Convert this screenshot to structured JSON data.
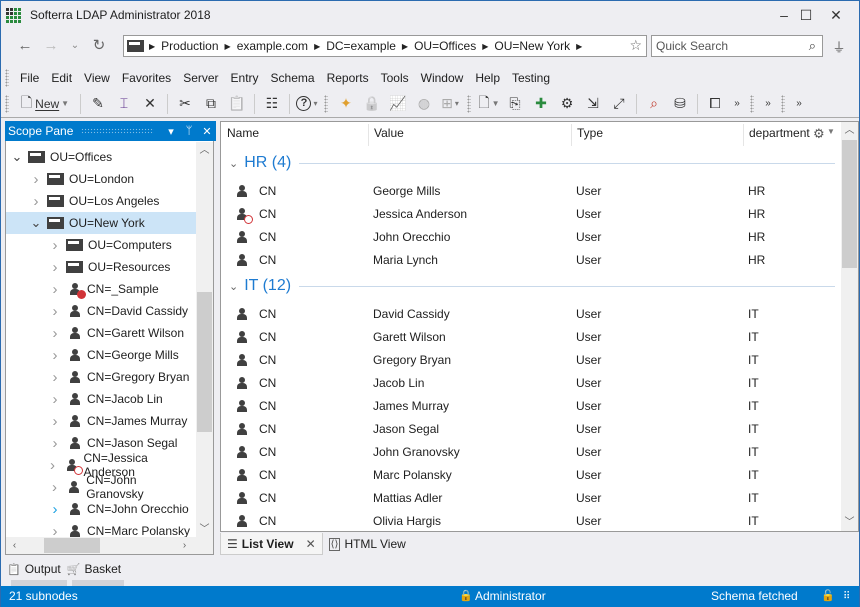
{
  "window": {
    "title": "Softerra LDAP Administrator 2018",
    "controls": {
      "minimize": "–",
      "maximize": "☐",
      "close": "✕"
    }
  },
  "nav": {
    "back_icon": "←",
    "forward_icon": "→",
    "history_icon": "⌄",
    "refresh_icon": "↻",
    "breadcrumbs": [
      "Production",
      "example.com",
      "DC=example",
      "OU=Offices",
      "OU=New York"
    ],
    "favorite_icon": "☆",
    "search_placeholder": "Quick Search",
    "search_value": "",
    "search_icon": "⌕",
    "connect_icon": "⏚"
  },
  "menu": [
    "File",
    "Edit",
    "View",
    "Favorites",
    "Server",
    "Entry",
    "Schema",
    "Reports",
    "Tools",
    "Window",
    "Help",
    "Testing"
  ],
  "toolbar": {
    "new_label": "New",
    "icons": {
      "new": "🗋",
      "edit": "✎",
      "rename": "⌶",
      "delete": "✕",
      "cut": "✂",
      "copy": "⧉",
      "paste": "📋",
      "properties": "☷",
      "help": "?",
      "new_entry": "✦",
      "lock": "🔒",
      "monitor": "📈",
      "web": "◍",
      "tree": "⊞",
      "new2": "🗋",
      "export": "⎘",
      "add_edit": "✚",
      "settings": "⚙",
      "import": "⇲",
      "expand": "⤢",
      "find": "⌕",
      "db": "⛁",
      "windows": "⧠",
      "more": "»"
    }
  },
  "scope_pane": {
    "title": "Scope Pane",
    "dropdown_icon": "▾",
    "pin_icon": "📌",
    "close_icon": "✕",
    "nodes": [
      {
        "label": "OU=Offices",
        "level": 0,
        "type": "folder",
        "expanded": true
      },
      {
        "label": "OU=London",
        "level": 1,
        "type": "folder",
        "expanded": false
      },
      {
        "label": "OU=Los Angeles",
        "level": 1,
        "type": "folder",
        "expanded": false
      },
      {
        "label": "OU=New York",
        "level": 1,
        "type": "folder",
        "expanded": true,
        "selected": true
      },
      {
        "label": "OU=Computers",
        "level": 2,
        "type": "folder",
        "expanded": false
      },
      {
        "label": "OU=Resources",
        "level": 2,
        "type": "folder",
        "expanded": false
      },
      {
        "label": "CN=_Sample",
        "level": 2,
        "type": "user-disabled",
        "expanded": false
      },
      {
        "label": "CN=David Cassidy",
        "level": 2,
        "type": "user",
        "expanded": false
      },
      {
        "label": "CN=Garett Wilson",
        "level": 2,
        "type": "user",
        "expanded": false
      },
      {
        "label": "CN=George Mills",
        "level": 2,
        "type": "user",
        "expanded": false
      },
      {
        "label": "CN=Gregory Bryan",
        "level": 2,
        "type": "user",
        "expanded": false
      },
      {
        "label": "CN=Jacob Lin",
        "level": 2,
        "type": "user",
        "expanded": false
      },
      {
        "label": "CN=James Murray",
        "level": 2,
        "type": "user",
        "expanded": false
      },
      {
        "label": "CN=Jason Segal",
        "level": 2,
        "type": "user",
        "expanded": false
      },
      {
        "label": "CN=Jessica Anderson",
        "level": 2,
        "type": "user-expiring",
        "expanded": false
      },
      {
        "label": "CN=John Granovsky",
        "level": 2,
        "type": "user",
        "expanded": false
      },
      {
        "label": "CN=John Orecchio",
        "level": 2,
        "type": "user",
        "expanded": false,
        "hover": true
      },
      {
        "label": "CN=Marc Polansky",
        "level": 2,
        "type": "user",
        "expanded": false
      }
    ]
  },
  "bottom_tabs": [
    {
      "label": "Output",
      "icon": "📋"
    },
    {
      "label": "Basket",
      "icon": "🛒"
    }
  ],
  "list_view": {
    "columns": [
      "Name",
      "Value",
      "Type",
      "department"
    ],
    "column_options_icon": "⚙",
    "groups": [
      {
        "title": "HR (4)",
        "rows": [
          {
            "name": "CN",
            "value": "George Mills",
            "type": "User",
            "department": "HR",
            "icon": "user"
          },
          {
            "name": "CN",
            "value": "Jessica Anderson",
            "type": "User",
            "department": "HR",
            "icon": "user-expiring"
          },
          {
            "name": "CN",
            "value": "John Orecchio",
            "type": "User",
            "department": "HR",
            "icon": "user"
          },
          {
            "name": "CN",
            "value": "Maria Lynch",
            "type": "User",
            "department": "HR",
            "icon": "user"
          }
        ]
      },
      {
        "title": "IT (12)",
        "rows": [
          {
            "name": "CN",
            "value": "David Cassidy",
            "type": "User",
            "department": "IT",
            "icon": "user"
          },
          {
            "name": "CN",
            "value": "Garett Wilson",
            "type": "User",
            "department": "IT",
            "icon": "user"
          },
          {
            "name": "CN",
            "value": "Gregory Bryan",
            "type": "User",
            "department": "IT",
            "icon": "user"
          },
          {
            "name": "CN",
            "value": "Jacob Lin",
            "type": "User",
            "department": "IT",
            "icon": "user"
          },
          {
            "name": "CN",
            "value": "James Murray",
            "type": "User",
            "department": "IT",
            "icon": "user"
          },
          {
            "name": "CN",
            "value": "Jason Segal",
            "type": "User",
            "department": "IT",
            "icon": "user"
          },
          {
            "name": "CN",
            "value": "John Granovsky",
            "type": "User",
            "department": "IT",
            "icon": "user"
          },
          {
            "name": "CN",
            "value": "Marc Polansky",
            "type": "User",
            "department": "IT",
            "icon": "user"
          },
          {
            "name": "CN",
            "value": "Mattias Adler",
            "type": "User",
            "department": "IT",
            "icon": "user"
          },
          {
            "name": "CN",
            "value": "Olivia Hargis",
            "type": "User",
            "department": "IT",
            "icon": "user"
          }
        ]
      }
    ]
  },
  "view_tabs": [
    {
      "label": "List View",
      "active": true,
      "icon": "☰",
      "close": "✕"
    },
    {
      "label": "HTML View",
      "active": false,
      "icon": "⟨⟩"
    }
  ],
  "status": {
    "subnodes": "21 subnodes",
    "user": "Administrator",
    "user_icon": "👤",
    "schema": "Schema fetched",
    "lock_icon": "🔓",
    "grip": "⠿"
  },
  "colors": {
    "accent": "#007acc",
    "group_title": "#1e7bd1",
    "selection": "#cce4f7",
    "error_badge": "#d13438"
  }
}
